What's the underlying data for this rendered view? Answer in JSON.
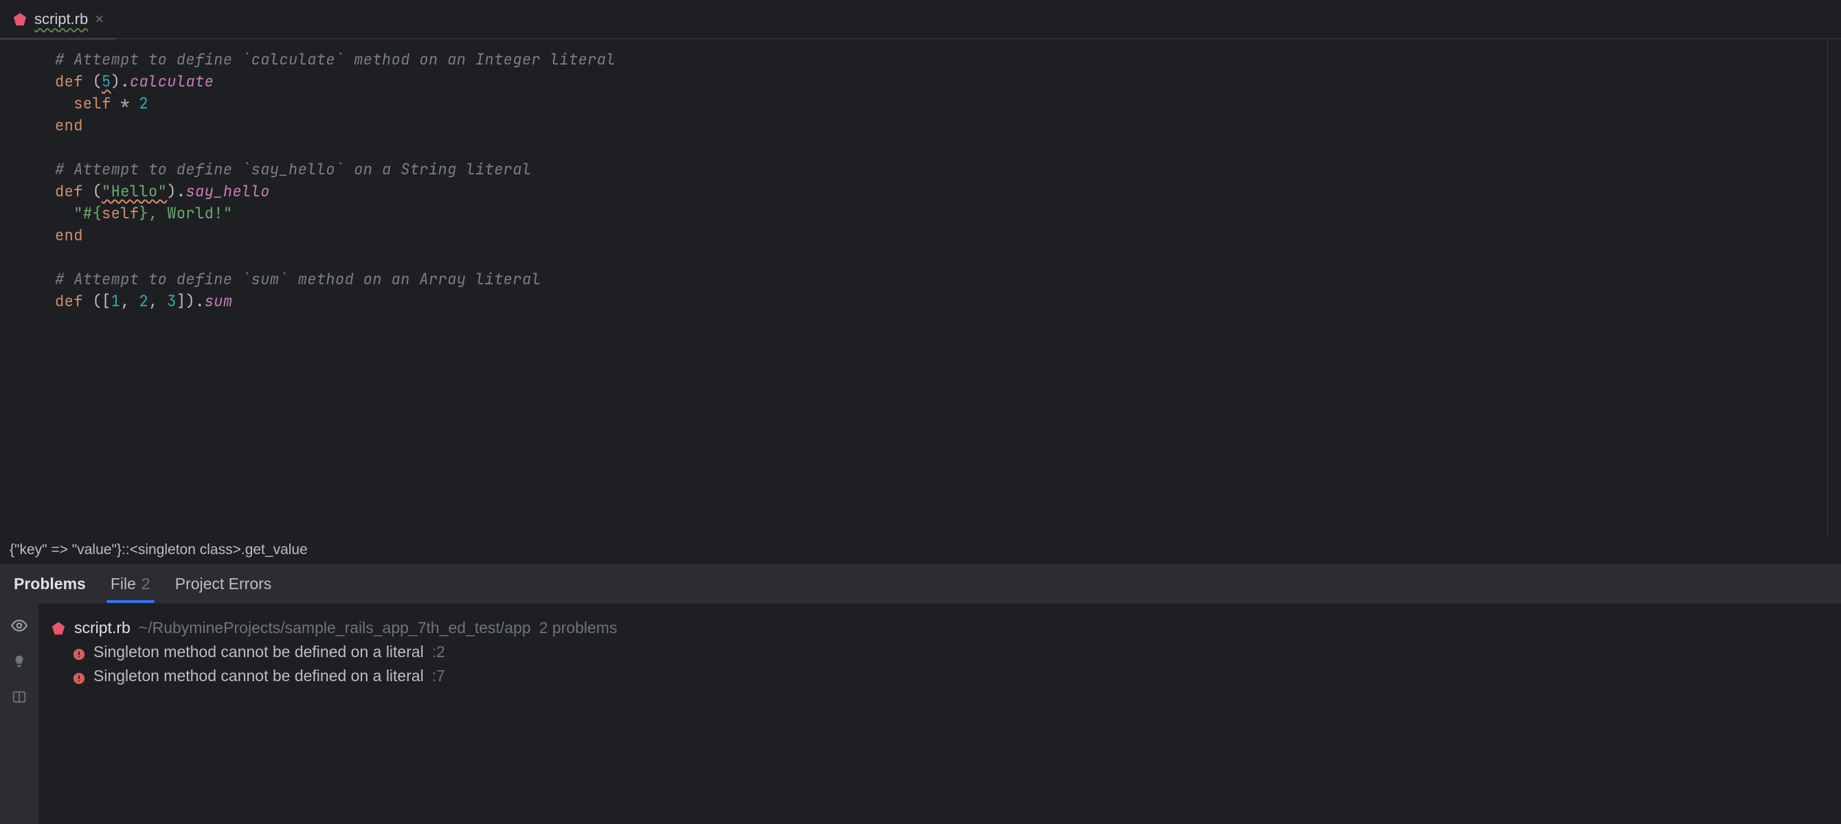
{
  "tab": {
    "filename": "script.rb"
  },
  "code": {
    "c1": "# Attempt to define `calculate` method on an Integer literal",
    "def": "def",
    "lp": "(",
    "rp": ")",
    "dot": ".",
    "calc_lit": "5",
    "calc_name": "calculate",
    "self": "self",
    "star": " * ",
    "two": "2",
    "end": "end",
    "c2": "# Attempt to define `say_hello` on a String literal",
    "hello_lit": "\"Hello\"",
    "hello_name": "say_hello",
    "interp_open": "\"#{",
    "interp_self": "self",
    "interp_close": "}",
    "world": ", World!\"",
    "c3": "# Attempt to define `sum` method on an Array literal",
    "lbrack": "[",
    "a1": "1",
    "comma": ", ",
    "a2": "2",
    "a3": "3",
    "rbrack": "]",
    "sum_name": "sum"
  },
  "breadcrumb": {
    "text": "{\"key\" => \"value\"}::<singleton class>.get_value"
  },
  "problems": {
    "tab_problems": "Problems",
    "tab_file": "File",
    "tab_file_count": "2",
    "tab_project": "Project Errors",
    "file": {
      "name": "script.rb",
      "path": "~/RubymineProjects/sample_rails_app_7th_ed_test/app",
      "count_label": "2 problems"
    },
    "items": [
      {
        "message": "Singleton method cannot be defined on a literal",
        "line": ":2"
      },
      {
        "message": "Singleton method cannot be defined on a literal",
        "line": ":7"
      }
    ]
  }
}
